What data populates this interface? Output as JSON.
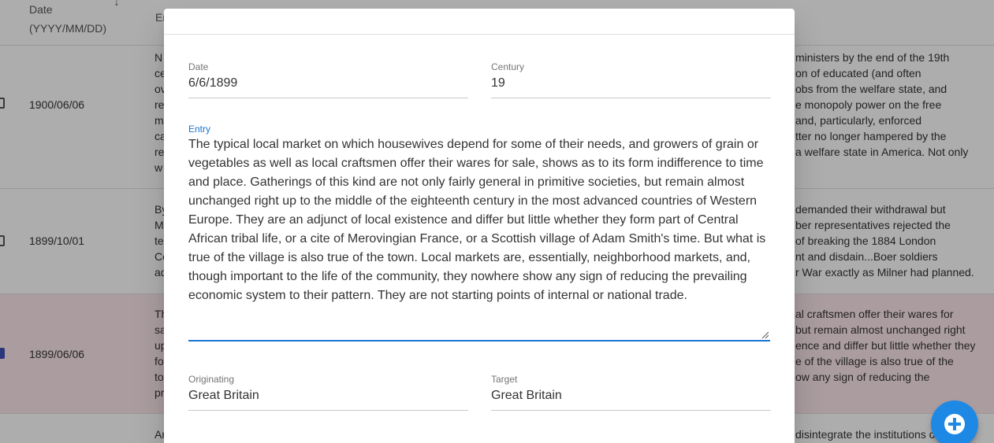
{
  "table": {
    "header_date": "Date\n(YYYY/MM/DD)",
    "header_entry": "En",
    "rows": [
      {
        "date": "1900/06/06",
        "left_text": "N\nce\nov\nre\nm\nca\nre\nw",
        "right_text": "ministers by the end of the 19th\non of educated (and often\nobs from the welfare state, and\ne monopoly power on the free\nand, particularly, enforced\ntter no longer hampered by the\na welfare state in America. Not only",
        "selected": false
      },
      {
        "date": "1899/10/01",
        "left_text": "By\nM\nte\nCo\nad",
        "right_text": "demanded their withdrawal but\nber representatives rejected the\nof breaking the 1884 London\nnt and disdain...Boer soldiers\nr War exactly as Milner had planned.",
        "selected": false
      },
      {
        "date": "1899/06/06",
        "left_text": "Th\nsa\nup\nfo\nto\npr",
        "right_text": "al craftsmen offer their wares for\nbut remain almost unchanged right\nence and differ but little whether they\ne of the village is also true of the\now any sign of reducing the",
        "selected": true
      },
      {
        "date": "",
        "left_text": "Ar",
        "right_text": "disintegrate the institutions o",
        "selected": false
      }
    ]
  },
  "dialog": {
    "date": {
      "label": "Date",
      "value": "6/6/1899"
    },
    "century": {
      "label": "Century",
      "value": "19"
    },
    "entry": {
      "label": "Entry",
      "value": "The typical local market on which housewives depend for some of their needs, and growers of grain or\nvegetables as well as local craftsmen offer their wares for sale, shows as to its form indifference to time\nand place. Gatherings of this kind are not only fairly general in primitive societies, but remain almost\nunchanged right up to the middle of the eighteenth century in the most advanced countries of Western\nEurope. They are an adjunct of local existence and differ but little whether they form part of Central\nAfrican tribal life, or a cite of Merovingian France, or a Scottish village of Adam Smith's time. But what is\ntrue of the village is also true of the town. Local markets are, essentially, neighborhood markets, and,\nthough important to the life of the community, they nowhere show any sign of reducing the prevailing\neconomic system to their pattern. They are not starting points of internal or national trade."
    },
    "originating": {
      "label": "Originating",
      "value": "Great Britain"
    },
    "target": {
      "label": "Target",
      "value": "Great Britain"
    }
  },
  "fab": {
    "icon": "add-circle-icon",
    "color": "#1e88e5"
  },
  "colors": {
    "accent": "#1976d2",
    "selected_row": "#fde7ea",
    "checkbox": "#3f51b5"
  }
}
